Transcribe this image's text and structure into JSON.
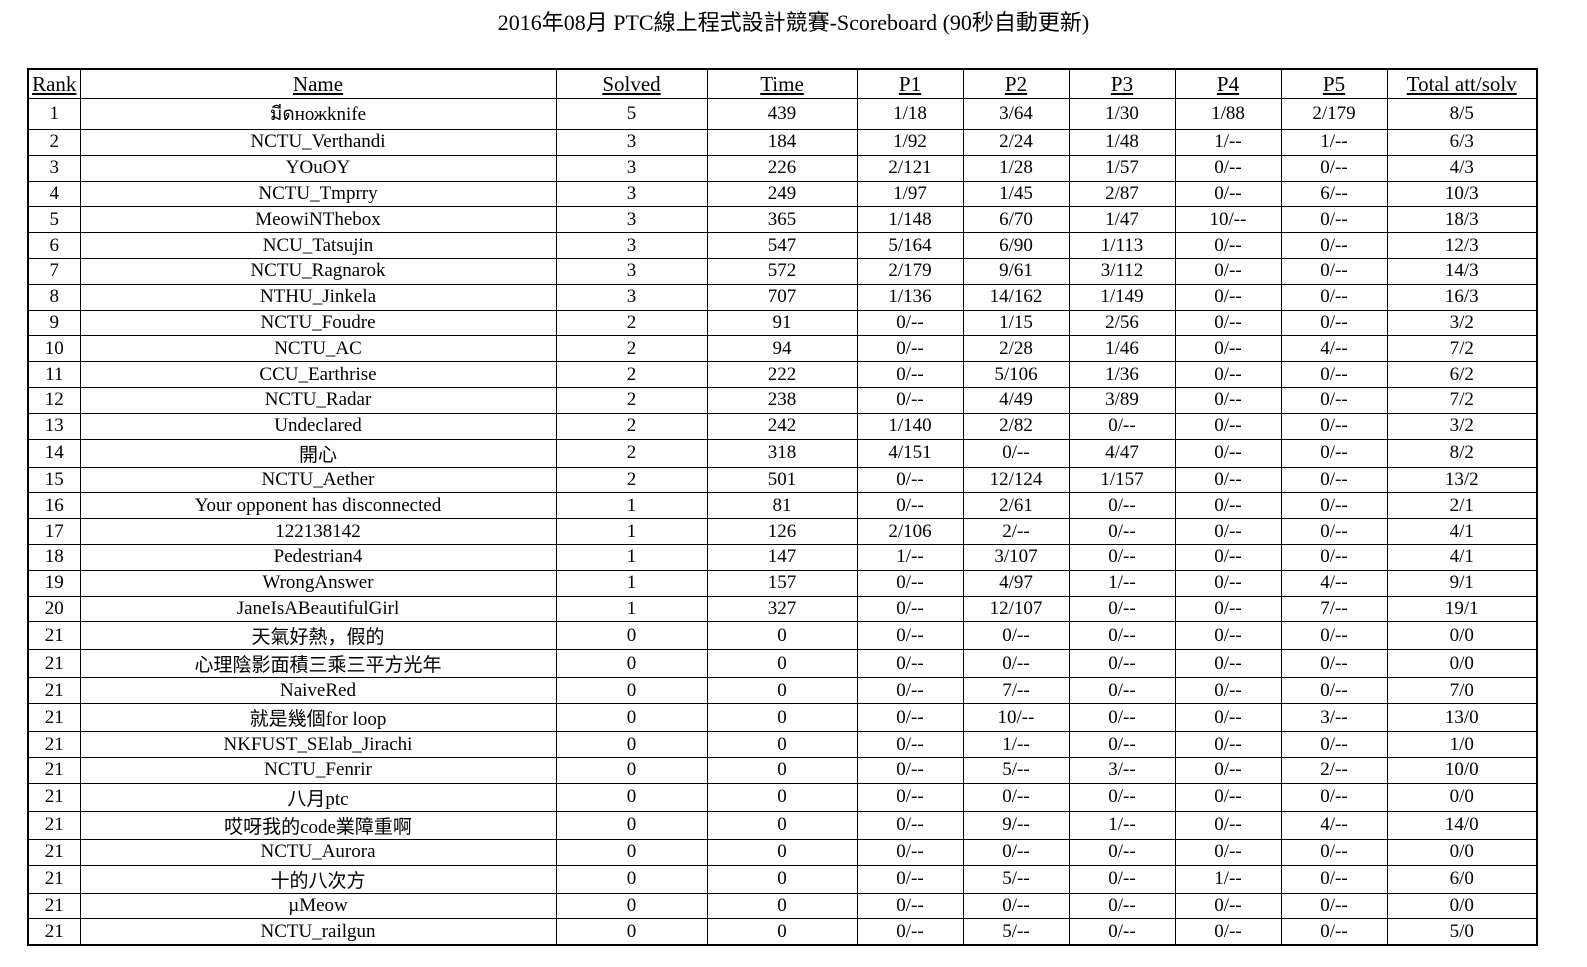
{
  "title": "2016年08月 PTC線上程式設計競賽-Scoreboard (90秒自動更新)",
  "columns": [
    "Rank",
    "Name",
    "Solved",
    "Time",
    "P1",
    "P2",
    "P3",
    "P4",
    "P5",
    "Total att/solv"
  ],
  "rows": [
    [
      "1",
      "มีดножknife",
      "5",
      "439",
      "1/18",
      "3/64",
      "1/30",
      "1/88",
      "2/179",
      "8/5"
    ],
    [
      "2",
      "NCTU_Verthandi",
      "3",
      "184",
      "1/92",
      "2/24",
      "1/48",
      "1/--",
      "1/--",
      "6/3"
    ],
    [
      "3",
      "YOuOY",
      "3",
      "226",
      "2/121",
      "1/28",
      "1/57",
      "0/--",
      "0/--",
      "4/3"
    ],
    [
      "4",
      "NCTU_Tmprry",
      "3",
      "249",
      "1/97",
      "1/45",
      "2/87",
      "0/--",
      "6/--",
      "10/3"
    ],
    [
      "5",
      "MeowiNThebox",
      "3",
      "365",
      "1/148",
      "6/70",
      "1/47",
      "10/--",
      "0/--",
      "18/3"
    ],
    [
      "6",
      "NCU_Tatsujin",
      "3",
      "547",
      "5/164",
      "6/90",
      "1/113",
      "0/--",
      "0/--",
      "12/3"
    ],
    [
      "7",
      "NCTU_Ragnarok",
      "3",
      "572",
      "2/179",
      "9/61",
      "3/112",
      "0/--",
      "0/--",
      "14/3"
    ],
    [
      "8",
      "NTHU_Jinkela",
      "3",
      "707",
      "1/136",
      "14/162",
      "1/149",
      "0/--",
      "0/--",
      "16/3"
    ],
    [
      "9",
      "NCTU_Foudre",
      "2",
      "91",
      "0/--",
      "1/15",
      "2/56",
      "0/--",
      "0/--",
      "3/2"
    ],
    [
      "10",
      "NCTU_AC",
      "2",
      "94",
      "0/--",
      "2/28",
      "1/46",
      "0/--",
      "4/--",
      "7/2"
    ],
    [
      "11",
      "CCU_Earthrise",
      "2",
      "222",
      "0/--",
      "5/106",
      "1/36",
      "0/--",
      "0/--",
      "6/2"
    ],
    [
      "12",
      "NCTU_Radar",
      "2",
      "238",
      "0/--",
      "4/49",
      "3/89",
      "0/--",
      "0/--",
      "7/2"
    ],
    [
      "13",
      "Undeclared",
      "2",
      "242",
      "1/140",
      "2/82",
      "0/--",
      "0/--",
      "0/--",
      "3/2"
    ],
    [
      "14",
      "開心",
      "2",
      "318",
      "4/151",
      "0/--",
      "4/47",
      "0/--",
      "0/--",
      "8/2"
    ],
    [
      "15",
      "NCTU_Aether",
      "2",
      "501",
      "0/--",
      "12/124",
      "1/157",
      "0/--",
      "0/--",
      "13/2"
    ],
    [
      "16",
      "Your opponent has disconnected",
      "1",
      "81",
      "0/--",
      "2/61",
      "0/--",
      "0/--",
      "0/--",
      "2/1"
    ],
    [
      "17",
      "122138142",
      "1",
      "126",
      "2/106",
      "2/--",
      "0/--",
      "0/--",
      "0/--",
      "4/1"
    ],
    [
      "18",
      "Pedestrian4",
      "1",
      "147",
      "1/--",
      "3/107",
      "0/--",
      "0/--",
      "0/--",
      "4/1"
    ],
    [
      "19",
      "WrongAnswer",
      "1",
      "157",
      "0/--",
      "4/97",
      "1/--",
      "0/--",
      "4/--",
      "9/1"
    ],
    [
      "20",
      "JaneIsABeautifulGirl",
      "1",
      "327",
      "0/--",
      "12/107",
      "0/--",
      "0/--",
      "7/--",
      "19/1"
    ],
    [
      "21",
      "天氣好熱，假的",
      "0",
      "0",
      "0/--",
      "0/--",
      "0/--",
      "0/--",
      "0/--",
      "0/0"
    ],
    [
      "21",
      "心理陰影面積三乘三平方光年",
      "0",
      "0",
      "0/--",
      "0/--",
      "0/--",
      "0/--",
      "0/--",
      "0/0"
    ],
    [
      "21",
      "NaiveRed",
      "0",
      "0",
      "0/--",
      "7/--",
      "0/--",
      "0/--",
      "0/--",
      "7/0"
    ],
    [
      "21",
      "就是幾個for loop",
      "0",
      "0",
      "0/--",
      "10/--",
      "0/--",
      "0/--",
      "3/--",
      "13/0"
    ],
    [
      "21",
      "NKFUST_SElab_Jirachi",
      "0",
      "0",
      "0/--",
      "1/--",
      "0/--",
      "0/--",
      "0/--",
      "1/0"
    ],
    [
      "21",
      "NCTU_Fenrir",
      "0",
      "0",
      "0/--",
      "5/--",
      "3/--",
      "0/--",
      "2/--",
      "10/0"
    ],
    [
      "21",
      "八月ptc",
      "0",
      "0",
      "0/--",
      "0/--",
      "0/--",
      "0/--",
      "0/--",
      "0/0"
    ],
    [
      "21",
      "哎呀我的code業障重啊",
      "0",
      "0",
      "0/--",
      "9/--",
      "1/--",
      "0/--",
      "4/--",
      "14/0"
    ],
    [
      "21",
      "NCTU_Aurora",
      "0",
      "0",
      "0/--",
      "0/--",
      "0/--",
      "0/--",
      "0/--",
      "0/0"
    ],
    [
      "21",
      "十的八次方",
      "0",
      "0",
      "0/--",
      "5/--",
      "0/--",
      "1/--",
      "0/--",
      "6/0"
    ],
    [
      "21",
      "µMeow",
      "0",
      "0",
      "0/--",
      "0/--",
      "0/--",
      "0/--",
      "0/--",
      "0/0"
    ],
    [
      "21",
      "NCTU_railgun",
      "0",
      "0",
      "0/--",
      "5/--",
      "0/--",
      "0/--",
      "0/--",
      "5/0"
    ]
  ]
}
